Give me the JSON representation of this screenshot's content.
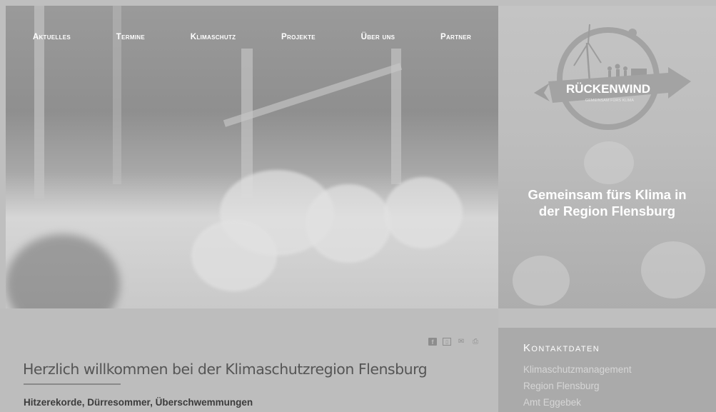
{
  "nav": {
    "items": [
      "Aktuelles",
      "Termine",
      "Klimaschutz",
      "Projekte",
      "Über uns",
      "Partner"
    ]
  },
  "logo": {
    "title": "RÜCKENWIND",
    "subtitle": "GEMEINSAM FÜRS KLIMA"
  },
  "hero": {
    "tagline_line1": "Gemeinsam fürs Klima in",
    "tagline_line2": "der Region Flensburg"
  },
  "share": {
    "icons": [
      "facebook-icon",
      "pdf-icon",
      "email-icon",
      "print-icon"
    ]
  },
  "main": {
    "title": "Herzlich willkommen bei der Klimaschutzregion Flensburg",
    "subtitle": "Hitzerekorde, Dürresommer, Überschwemmungen"
  },
  "contact": {
    "heading": "Kontaktdaten",
    "lines": [
      "Klimaschutzmanagement",
      "Region Flensburg",
      "Amt Eggebek"
    ]
  }
}
